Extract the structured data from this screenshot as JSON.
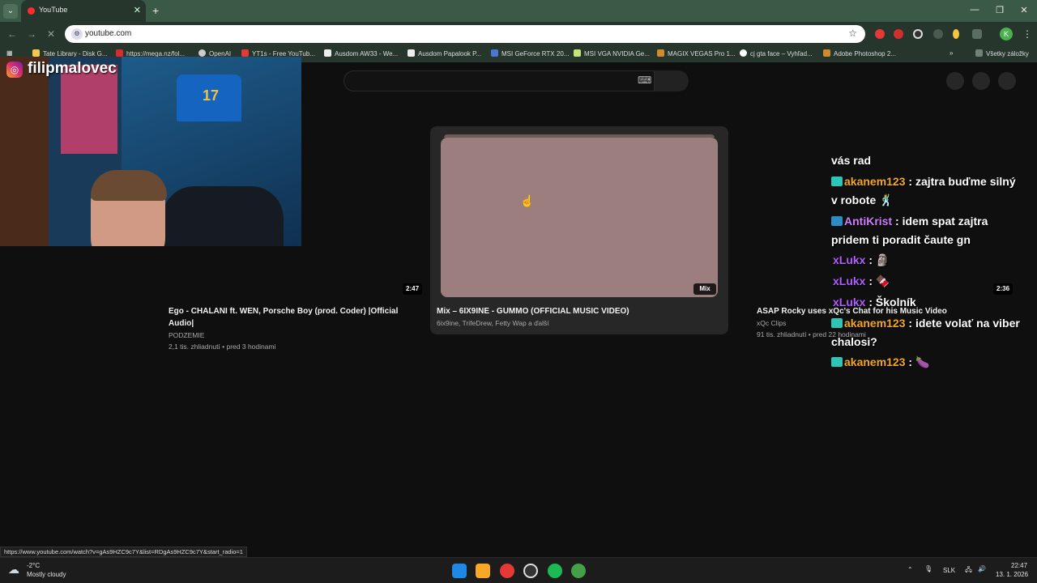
{
  "browser": {
    "tab_menu_icon": "chevron-down-icon",
    "tab_title": "YouTube",
    "tab_close": "✕",
    "new_tab": "+",
    "window_buttons": [
      "—",
      "❐",
      "✕"
    ],
    "url": "youtube.com",
    "bookmarks": [
      {
        "label": "Tate Library - Disk G...",
        "color": "#f2c94c"
      },
      {
        "label": "https://mega.nz/fol...",
        "color": "#d92b2b"
      },
      {
        "label": "OpenAI",
        "color": "#cccccc"
      },
      {
        "label": "YT1s - Free YouTub...",
        "color": "#e53935"
      },
      {
        "label": "Ausdom AW33 - We...",
        "color": "#eeeeee"
      },
      {
        "label": "Ausdom Papalook P...",
        "color": "#eeeeee"
      },
      {
        "label": "MSI GeForce RTX 20...",
        "color": "#4a77d4"
      },
      {
        "label": "MSI VGA NVIDIA Ge...",
        "color": "#c6e27a"
      },
      {
        "label": "MAGIX VEGAS Pro 1...",
        "color": "#d18b2b"
      },
      {
        "label": "cj gta face – Vyhľad...",
        "color": "#ffffff"
      },
      {
        "label": "Adobe Photoshop 2...",
        "color": "#d18b2b"
      }
    ],
    "all_bookmarks": "Všetky záložky",
    "profile_letter": "K"
  },
  "webcam": {
    "jersey_number": "17",
    "instagram_handle": "filipmalovec"
  },
  "videos": [
    {
      "title_line1": "Ego - CHALANI ft. WEN, Porsche Boy (prod. Coder) |Official",
      "title_line2": "Audio|",
      "channel": "PODZEMIE",
      "meta": "2,1 tis. zhliadnutí • pred 3 hodinami",
      "duration": "2:47"
    },
    {
      "title": "Mix – 6IX9INE - GUMMO (OFFICIAL MUSIC VIDEO)",
      "channel": "6ix9ine, TrifeDrew, Fetty Wap a ďalší",
      "badge": "Mix",
      "thumb_color": "#9c7e7e"
    },
    {
      "title": "ASAP Rocky uses xQc's Chat for his Music Video",
      "channel": "xQc Clips",
      "meta": "91 tis. zhliadnutí • pred 22 hodinami",
      "duration": "2:36"
    }
  ],
  "chat": [
    {
      "user": "",
      "text": "vás rad",
      "color": "#ffffff"
    },
    {
      "user": "akanem123",
      "text": " : zajtra buďme silný",
      "color": "#f5a623"
    },
    {
      "user": "",
      "text": "v robote 🕺",
      "color": "#ffffff"
    },
    {
      "user": "AntiKrist",
      "text": " : idem spat zajtra",
      "color": "#d07aff"
    },
    {
      "user": "",
      "text": "pridem ti poradit čaute gn",
      "color": "#ffffff"
    },
    {
      "user": "xLukx",
      "text": " : 🗿",
      "color": "#b05cff"
    },
    {
      "user": "xLukx",
      "text": " : 🍫",
      "color": "#b05cff"
    },
    {
      "user": "xLukx",
      "text": " : Školník",
      "color": "#b05cff"
    },
    {
      "user": "akanem123",
      "text": " : idete volať na viber",
      "color": "#f5a623"
    },
    {
      "user": "",
      "text": "chalosi?",
      "color": "#ffffff"
    },
    {
      "user": "akanem123",
      "text": " : 🍆",
      "color": "#f5a623"
    }
  ],
  "status_url": "https://www.youtube.com/watch?v=gAs9HZC9c7Y&list=RDgAs9HZC9c7Y&start_radio=1",
  "taskbar": {
    "weather_temp": "-2°C",
    "weather_desc": "Mostly cloudy",
    "language": "SLK",
    "time": "22:47",
    "date": "13. 1. 2026"
  }
}
